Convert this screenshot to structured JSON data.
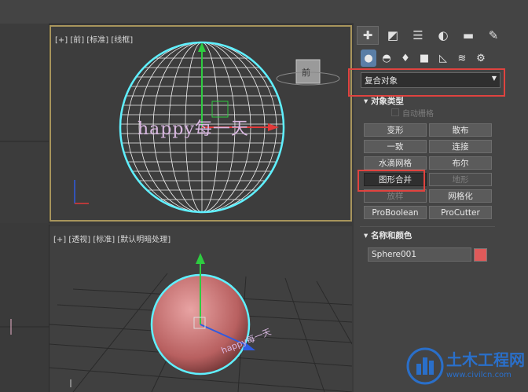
{
  "viewports": {
    "front_label": "[+] [前] [标准] [线框]",
    "perspective_label": "[+] [透视] [标准] [默认明暗处理]",
    "viewcube_label": "前",
    "front_text_object": "happy每一天",
    "persp_text_object": "happy每一天"
  },
  "panel": {
    "tabs": [
      "create-tab",
      "modify-tab",
      "hierarchy-tab",
      "motion-tab",
      "display-tab",
      "utilities-tab"
    ],
    "subtabs": [
      "geometry",
      "shapes",
      "lights",
      "cameras",
      "helpers",
      "spacewarps",
      "systems"
    ],
    "category_dropdown": "复合对象",
    "object_type_title": "对象类型",
    "auto_grid_label": "自动栅格",
    "buttons": [
      {
        "label": "变形",
        "state": "normal"
      },
      {
        "label": "散布",
        "state": "normal"
      },
      {
        "label": "一致",
        "state": "normal"
      },
      {
        "label": "连接",
        "state": "normal"
      },
      {
        "label": "水滴网格",
        "state": "normal"
      },
      {
        "label": "布尔",
        "state": "normal"
      },
      {
        "label": "图形合并",
        "state": "pressed"
      },
      {
        "label": "地形",
        "state": "disabled"
      },
      {
        "label": "放样",
        "state": "disabled"
      },
      {
        "label": "网格化",
        "state": "normal"
      },
      {
        "label": "ProBoolean",
        "state": "normal"
      },
      {
        "label": "ProCutter",
        "state": "normal"
      }
    ],
    "name_color_title": "名称和颜色",
    "object_name": "Sphere001",
    "object_color": "#e05a5a"
  },
  "watermark": {
    "title": "土木工程网",
    "url": "www.civilcn.com"
  },
  "colors": {
    "highlight": "#e0433f",
    "wire": "#5ff0ff",
    "active_border": "#a8955c"
  }
}
